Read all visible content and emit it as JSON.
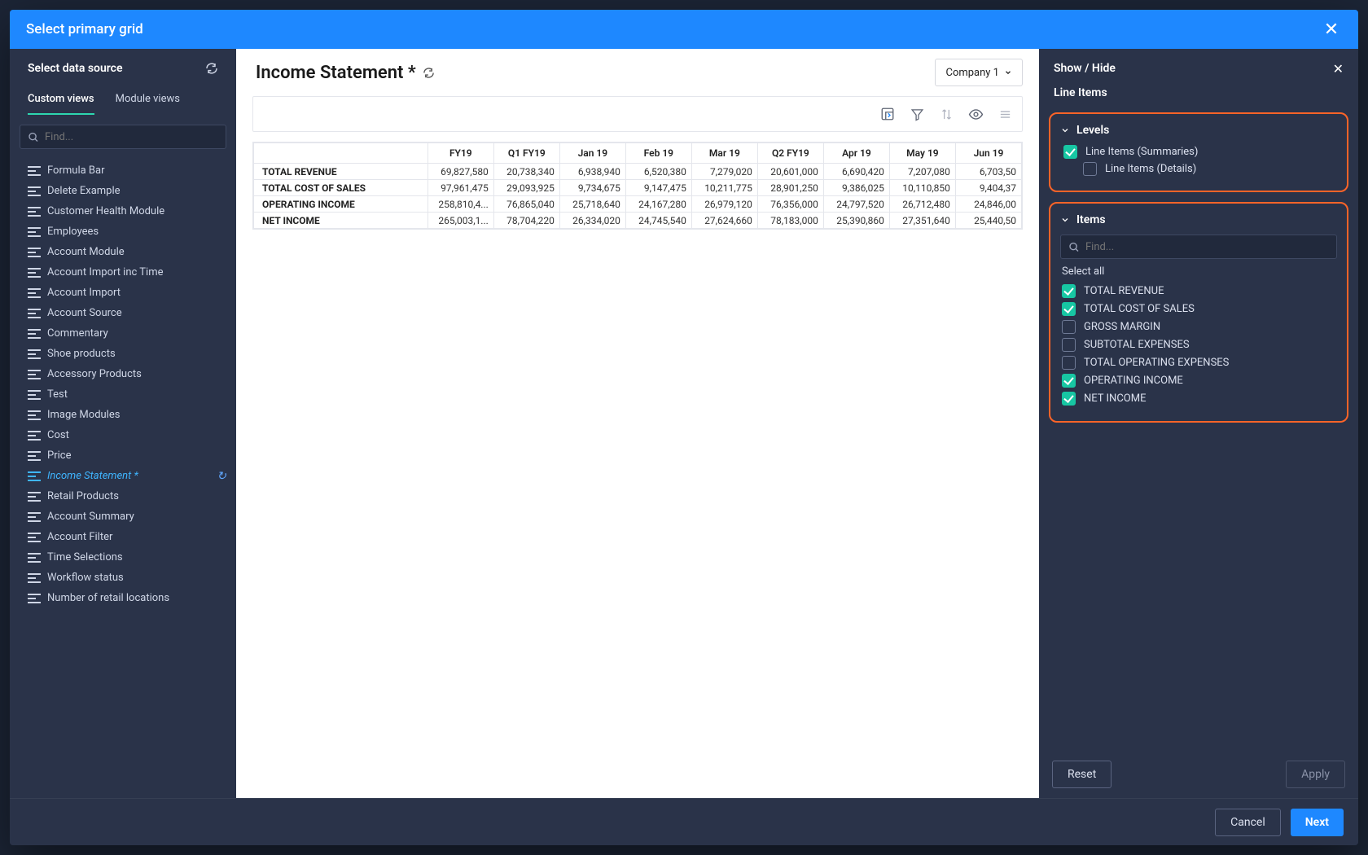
{
  "modal_title": "Select primary grid",
  "left": {
    "header": "Select data source",
    "tabs": {
      "custom": "Custom views",
      "module": "Module views"
    },
    "search_placeholder": "Find...",
    "items": [
      "Formula Bar",
      "Delete Example",
      "Customer Health Module",
      "Employees",
      "Account Module",
      "Account Import inc Time",
      "Account Import",
      "Account Source",
      "Commentary",
      "Shoe products",
      "Accessory Products",
      "Test",
      "Image Modules",
      "Cost",
      "Price",
      "Income Statement *",
      "Retail Products",
      "Account Summary",
      "Account Filter",
      "Time Selections",
      "Workflow status",
      "Number of retail locations"
    ],
    "active_index": 15
  },
  "center": {
    "title": "Income Statement *",
    "company": "Company 1",
    "columns": [
      "FY19",
      "Q1 FY19",
      "Jan 19",
      "Feb 19",
      "Mar 19",
      "Q2 FY19",
      "Apr 19",
      "May 19",
      "Jun 19"
    ],
    "rows": [
      {
        "label": "TOTAL REVENUE",
        "vals": [
          "69,827,580",
          "20,738,340",
          "6,938,940",
          "6,520,380",
          "7,279,020",
          "20,601,000",
          "6,690,420",
          "7,207,080",
          "6,703,50"
        ]
      },
      {
        "label": "TOTAL COST OF SALES",
        "vals": [
          "97,961,475",
          "29,093,925",
          "9,734,675",
          "9,147,475",
          "10,211,775",
          "28,901,250",
          "9,386,025",
          "10,110,850",
          "9,404,37"
        ]
      },
      {
        "label": "OPERATING INCOME",
        "vals": [
          "258,810,4...",
          "76,865,040",
          "25,718,640",
          "24,167,280",
          "26,979,120",
          "76,356,000",
          "24,797,520",
          "26,712,480",
          "24,846,00"
        ]
      },
      {
        "label": "NET INCOME",
        "vals": [
          "265,003,1...",
          "78,704,220",
          "26,334,020",
          "24,745,540",
          "27,624,660",
          "78,183,000",
          "25,390,860",
          "27,351,640",
          "25,440,50"
        ]
      }
    ]
  },
  "right": {
    "header": "Show / Hide",
    "sub": "Line Items",
    "levels_label": "Levels",
    "items_label": "Items",
    "search_placeholder": "Find...",
    "select_all": "Select all",
    "levels": [
      {
        "label": "Line Items (Summaries)",
        "checked": true,
        "indent": false
      },
      {
        "label": "Line Items (Details)",
        "checked": false,
        "indent": true
      }
    ],
    "items": [
      {
        "label": "TOTAL REVENUE",
        "checked": true
      },
      {
        "label": "TOTAL COST OF SALES",
        "checked": true
      },
      {
        "label": "GROSS MARGIN",
        "checked": false
      },
      {
        "label": "SUBTOTAL EXPENSES",
        "checked": false
      },
      {
        "label": "TOTAL OPERATING EXPENSES",
        "checked": false
      },
      {
        "label": "OPERATING INCOME",
        "checked": true
      },
      {
        "label": "NET INCOME",
        "checked": true
      }
    ],
    "reset": "Reset",
    "apply": "Apply"
  },
  "footer": {
    "cancel": "Cancel",
    "next": "Next"
  }
}
